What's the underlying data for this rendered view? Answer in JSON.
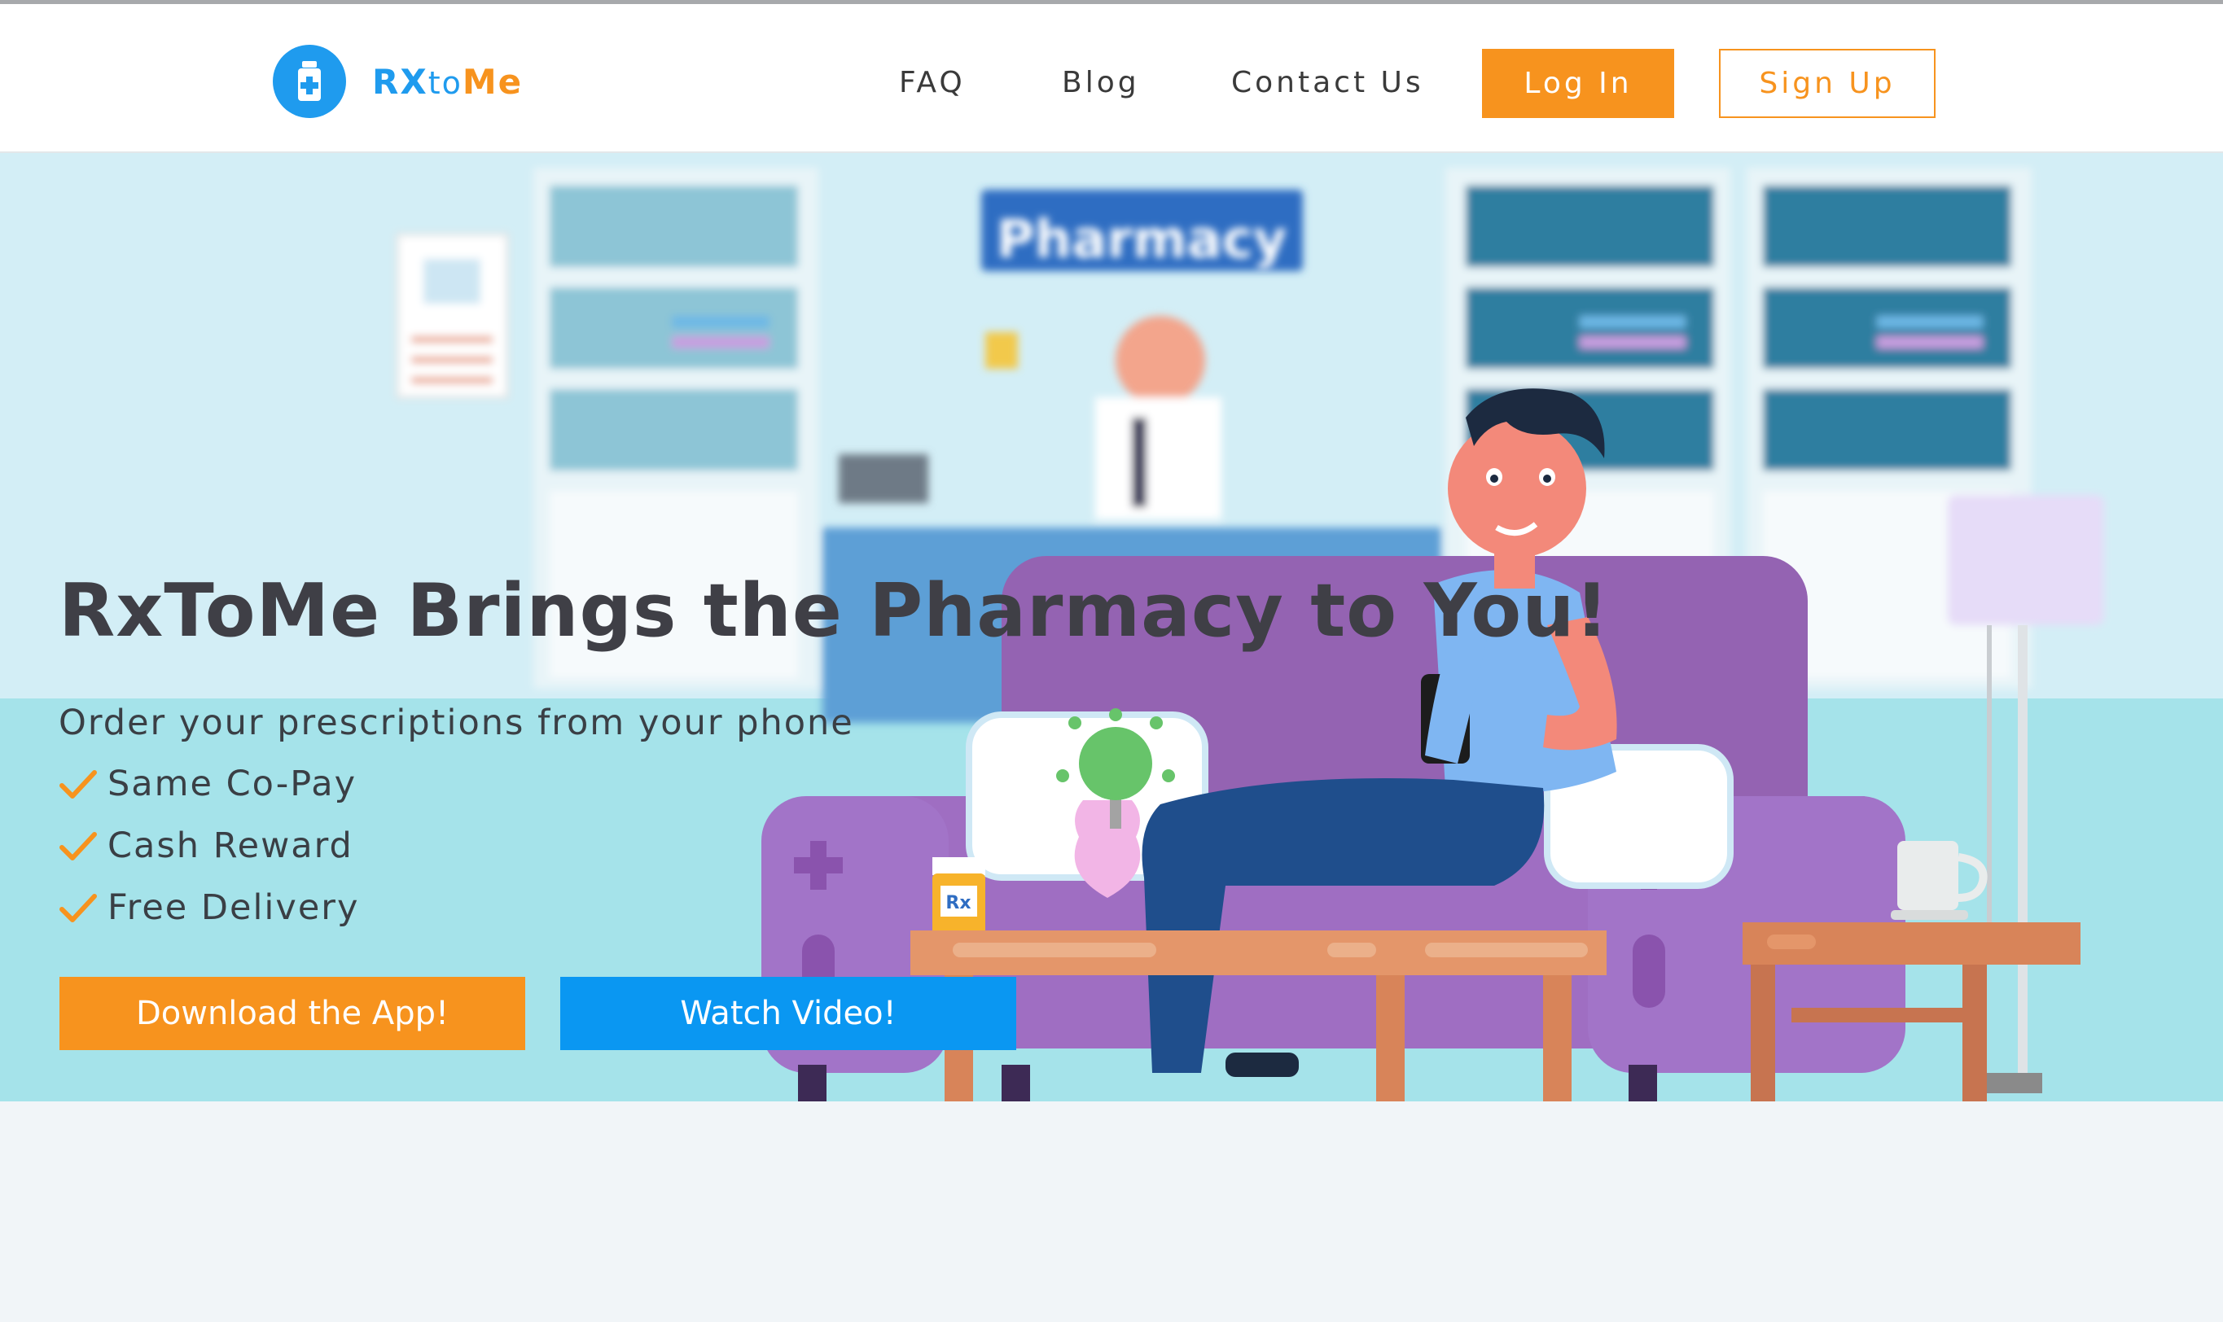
{
  "brand": {
    "name_part1": "RX",
    "name_part2": "to",
    "name_part3": "Me",
    "icon": "pill-bottle-icon",
    "color_primary": "#1f9bee",
    "color_accent": "#f7931e"
  },
  "nav": {
    "faq": "FAQ",
    "blog": "Blog",
    "contact": "Contact Us",
    "login": "Log In",
    "signup": "Sign Up"
  },
  "hero": {
    "title": "RxToMe Brings the Pharmacy to You!",
    "subtitle": "Order your prescriptions from your phone",
    "features": [
      "Same Co-Pay",
      "Cash Reward",
      "Free Delivery"
    ],
    "feature_icon": "checkmark-icon",
    "download_button": "Download the App!",
    "video_button": "Watch Video!",
    "sign_text": "Pharmacy",
    "rx_label": "Rx"
  }
}
